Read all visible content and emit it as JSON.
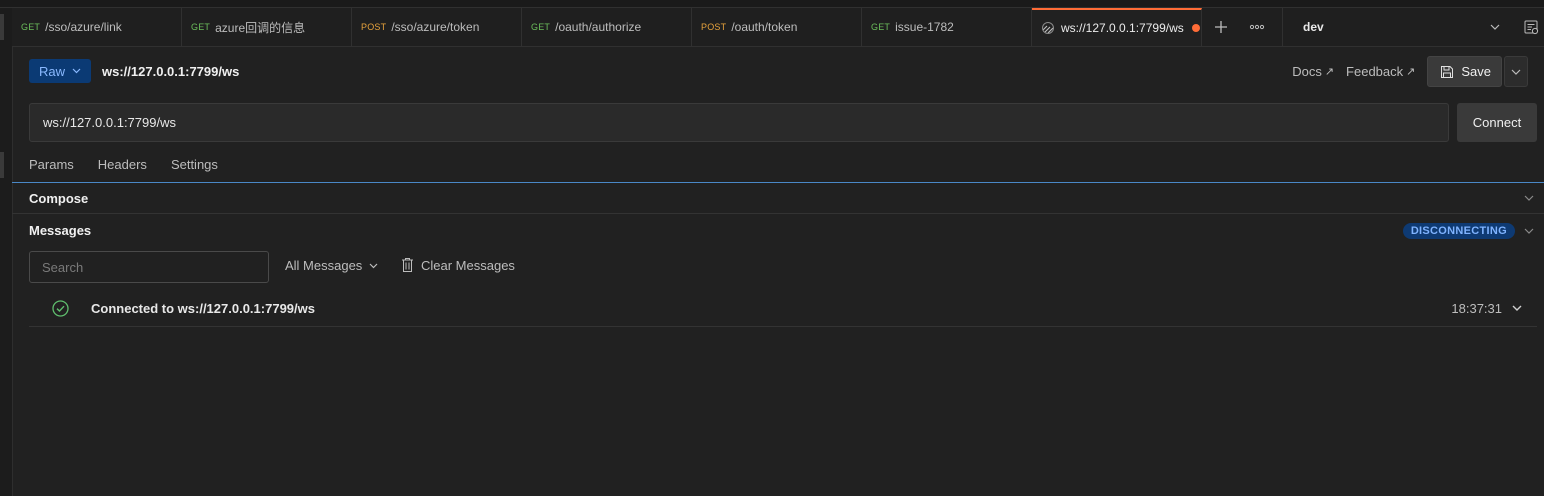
{
  "tabs": [
    {
      "method": "GET",
      "method_class": "get",
      "label": "/sso/azure/link"
    },
    {
      "method": "GET",
      "method_class": "get",
      "label": "azure回调的信息"
    },
    {
      "method": "POST",
      "method_class": "post",
      "label": "/sso/azure/token"
    },
    {
      "method": "GET",
      "method_class": "get",
      "label": "/oauth/authorize"
    },
    {
      "method": "POST",
      "method_class": "post",
      "label": "/oauth/token"
    },
    {
      "method": "GET",
      "method_class": "get",
      "label": "issue-1782"
    }
  ],
  "active_tab": {
    "label": "ws://127.0.0.1:7799/ws",
    "icon": "websocket-icon",
    "unsaved": true
  },
  "environment": {
    "name": "dev"
  },
  "request": {
    "mode_label": "Raw",
    "name": "ws://127.0.0.1:7799/ws",
    "url": "ws://127.0.0.1:7799/ws",
    "docs_label": "Docs",
    "feedback_label": "Feedback",
    "save_label": "Save",
    "connect_label": "Connect"
  },
  "subtabs": [
    "Params",
    "Headers",
    "Settings"
  ],
  "compose": {
    "title": "Compose"
  },
  "messages": {
    "title": "Messages",
    "status": "DISCONNECTING",
    "search_placeholder": "Search",
    "filter_label": "All Messages",
    "clear_label": "Clear Messages",
    "items": [
      {
        "text": "Connected to ws://127.0.0.1:7799/ws",
        "time": "18:37:31",
        "icon": "check-circle-icon"
      }
    ]
  },
  "colors": {
    "accent": "#ff6c37",
    "get": "#6bbd5b",
    "post": "#e6a23c",
    "status_badge": "#0e3a73",
    "link_line": "#4a88c7"
  }
}
